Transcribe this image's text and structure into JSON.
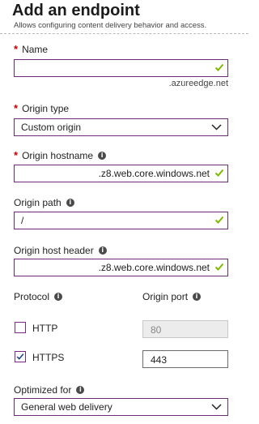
{
  "header": {
    "title": "Add an endpoint",
    "subtitle": "Allows configuring content delivery behavior and access."
  },
  "name": {
    "label": "Name",
    "value": "",
    "suffix": ".azureedge.net"
  },
  "origin_type": {
    "label": "Origin type",
    "value": "Custom origin"
  },
  "origin_hostname": {
    "label": "Origin hostname",
    "value": ".z8.web.core.windows.net"
  },
  "origin_path": {
    "label": "Origin path",
    "value": "/"
  },
  "origin_host_header": {
    "label": "Origin host header",
    "value": ".z8.web.core.windows.net"
  },
  "protocol": {
    "label": "Protocol",
    "http_label": "HTTP",
    "http_checked": false,
    "https_label": "HTTPS",
    "https_checked": true
  },
  "origin_port": {
    "label": "Origin port",
    "http_port": "80",
    "https_port": "443"
  },
  "optimized_for": {
    "label": "Optimized for",
    "value": "General web delivery"
  },
  "colors": {
    "accent": "#6b2b74",
    "valid_check": "#7fba00",
    "required": "#c80000"
  }
}
